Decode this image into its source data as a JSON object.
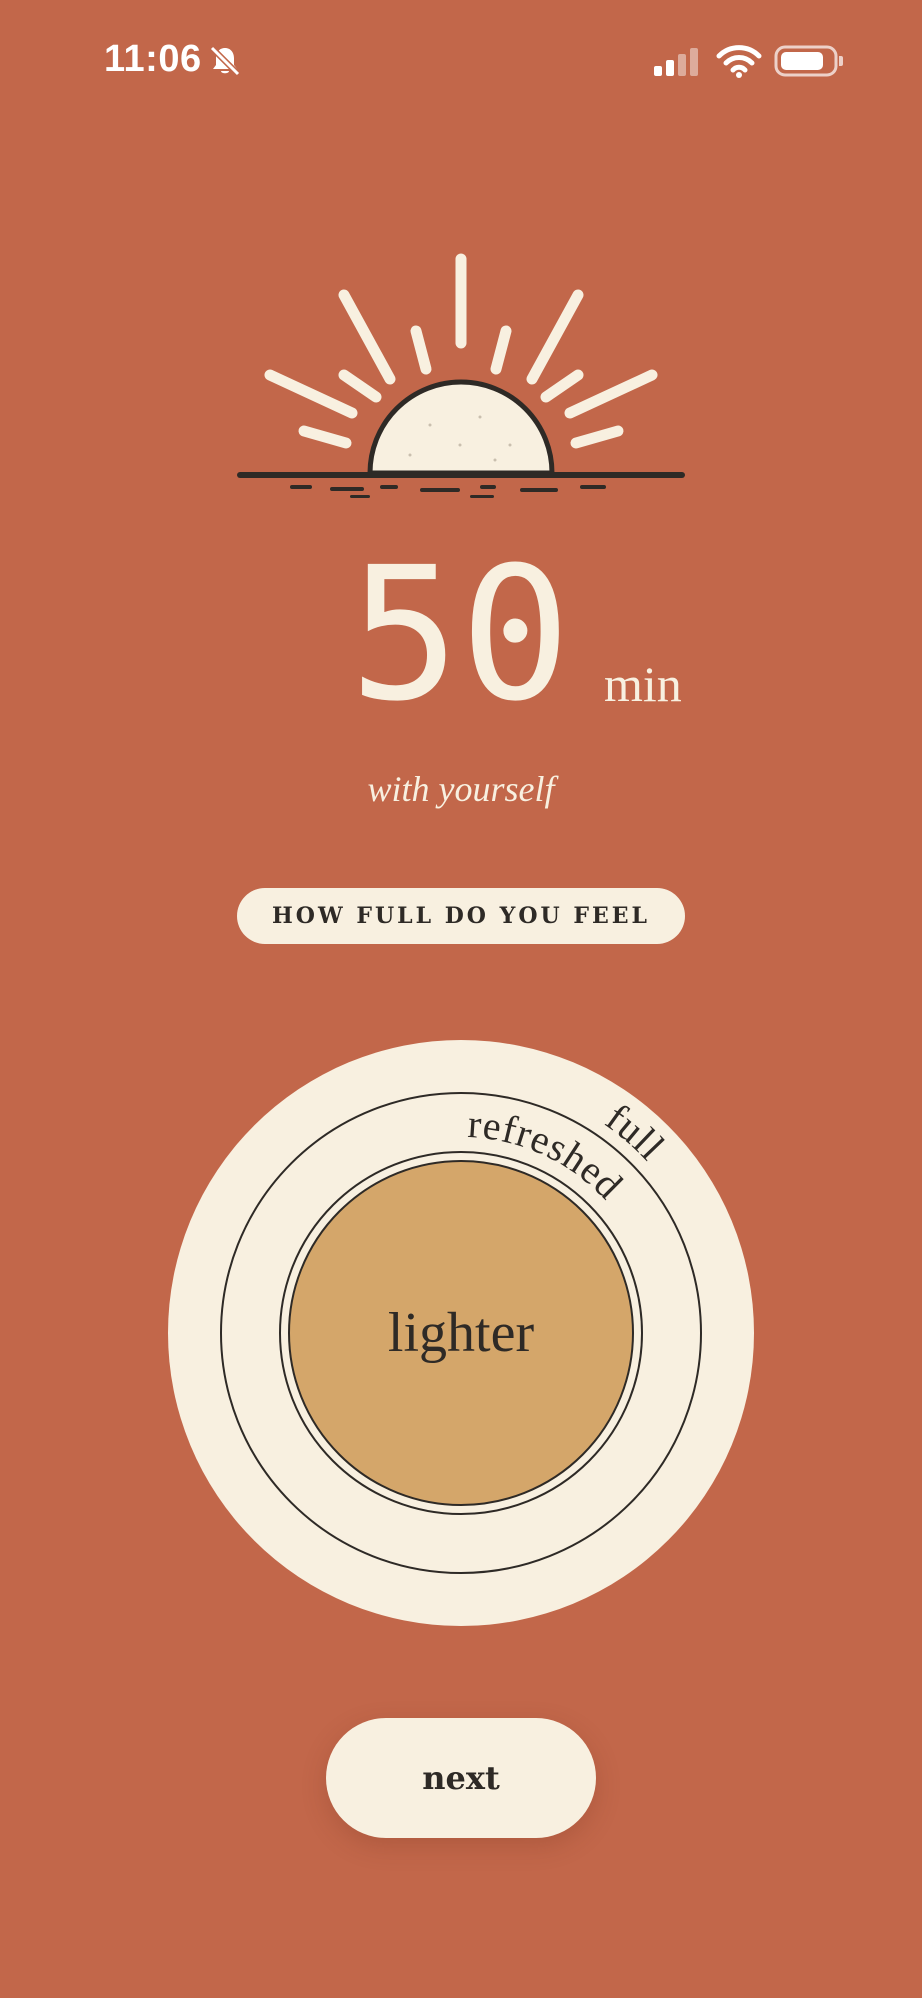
{
  "status_bar": {
    "time": "11:06",
    "icons": [
      "bell-slash-icon",
      "cellular-signal-icon",
      "wifi-icon",
      "battery-icon"
    ]
  },
  "hero": {
    "illustration": "sunrise-icon",
    "duration_value": "50",
    "duration_unit": "min",
    "caption": "with yourself"
  },
  "prompt": {
    "label": "HOW FULL DO YOU FEEL"
  },
  "dial": {
    "options": [
      "full",
      "refreshed",
      "lighter"
    ],
    "selected": "lighter",
    "outer_label": "full",
    "middle_label": "refreshed",
    "inner_label": "lighter"
  },
  "actions": {
    "next_label": "next"
  },
  "colors": {
    "background": "#C2674A",
    "cream": "#F8F0E0",
    "ink": "#2E2A26",
    "selected_fill": "#D4A66A"
  }
}
